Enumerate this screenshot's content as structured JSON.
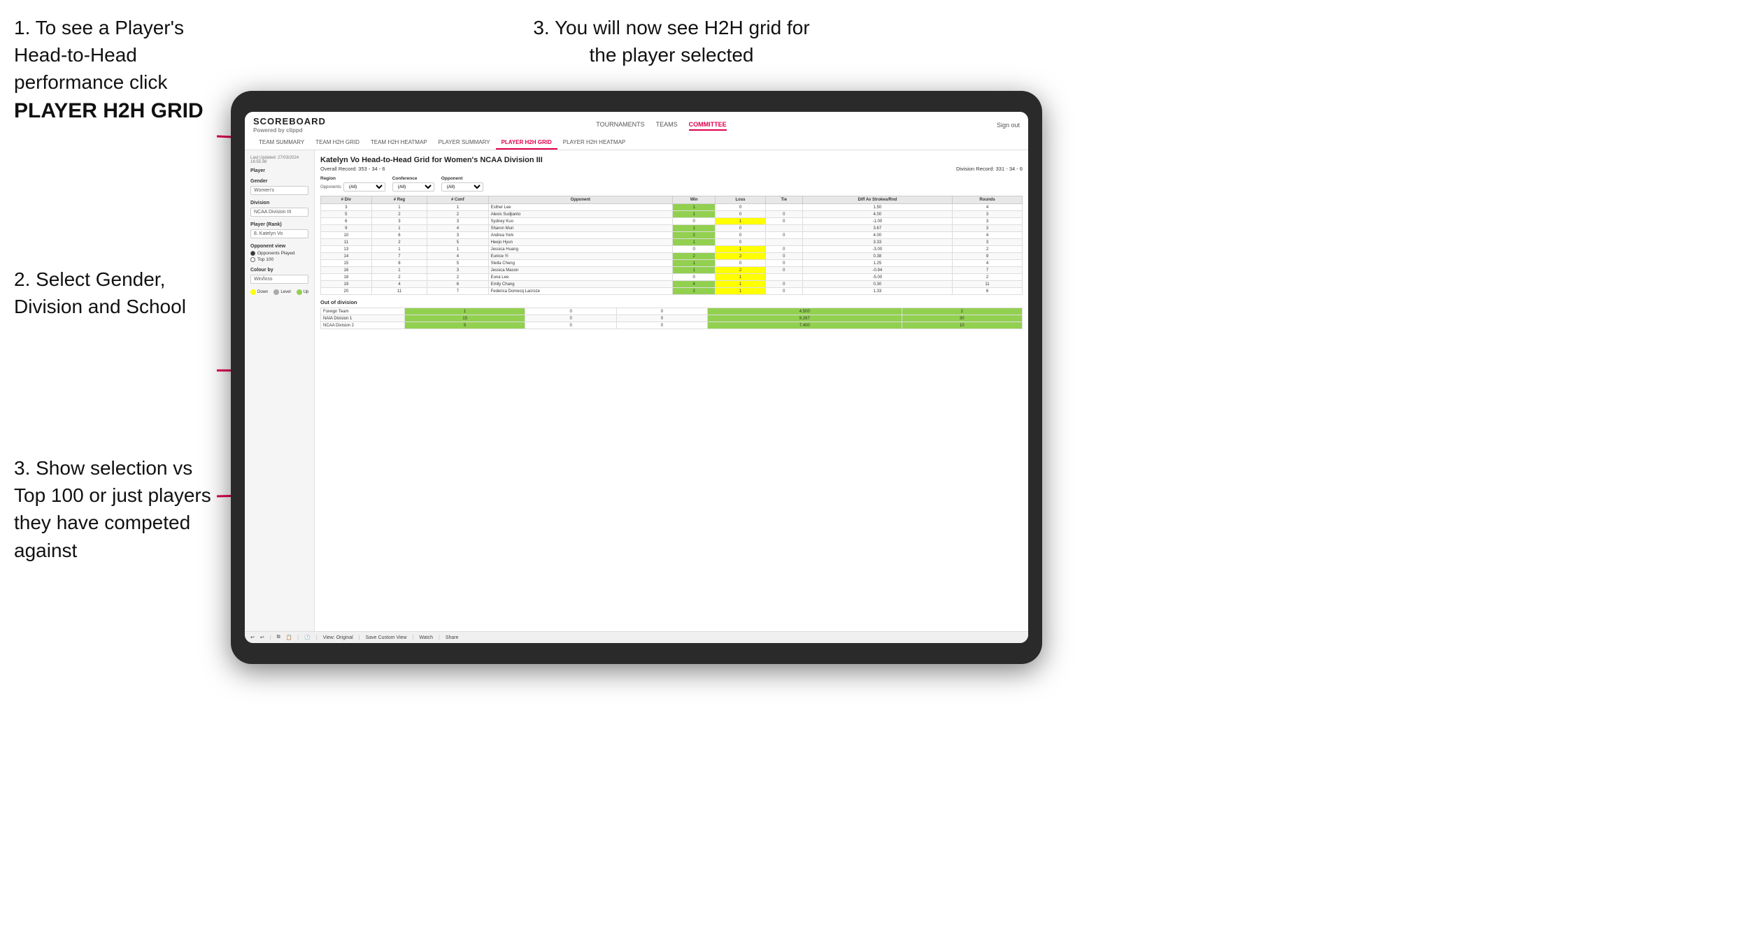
{
  "instructions": {
    "top_left_1": "1. To see a Player's Head-to-Head performance click",
    "top_left_2": "PLAYER H2H GRID",
    "top_right": "3. You will now see H2H grid for the player selected",
    "mid_left_title": "2. Select Gender, Division and School",
    "bottom_left_title": "3. Show selection vs Top 100 or just players they have competed against"
  },
  "nav": {
    "logo_main": "SCOREBOARD",
    "logo_sub": "Powered by clippd",
    "links": [
      "TOURNAMENTS",
      "TEAMS",
      "COMMITTEE"
    ],
    "active_link": "COMMITTEE",
    "sign_out": "Sign out",
    "sub_links": [
      "TEAM SUMMARY",
      "TEAM H2H GRID",
      "TEAM H2H HEATMAP",
      "PLAYER SUMMARY",
      "PLAYER H2H GRID",
      "PLAYER H2H HEATMAP"
    ],
    "active_sub": "PLAYER H2H GRID"
  },
  "sidebar": {
    "timestamp": "Last Updated: 27/03/2024 16:55:38",
    "player_label": "Player",
    "gender_label": "Gender",
    "gender_value": "Women's",
    "division_label": "Division",
    "division_value": "NCAA Division III",
    "player_rank_label": "Player (Rank)",
    "player_rank_value": "8. Katelyn Vo",
    "opponent_view_label": "Opponent view",
    "radio_opponents": "Opponents Played",
    "radio_top100": "Top 100",
    "colour_by_label": "Colour by",
    "colour_by_value": "Win/loss",
    "legend_down": "Down",
    "legend_level": "Level",
    "legend_up": "Up"
  },
  "grid": {
    "title": "Katelyn Vo Head-to-Head Grid for Women's NCAA Division III",
    "overall_record": "Overall Record: 353 - 34 - 6",
    "division_record": "Division Record: 331 - 34 - 6",
    "region_label": "Region",
    "conference_label": "Conference",
    "opponent_label": "Opponent",
    "opponents_label": "Opponents:",
    "opponents_value": "(All)",
    "columns": [
      "# Div",
      "# Reg",
      "# Conf",
      "Opponent",
      "Win",
      "Loss",
      "Tie",
      "Diff Av Strokes/Rnd",
      "Rounds"
    ],
    "rows": [
      {
        "div": "3",
        "reg": "1",
        "conf": "1",
        "name": "Esther Lee",
        "win": "1",
        "loss": "0",
        "tie": "",
        "diff": "1.50",
        "rounds": "4",
        "win_color": "green",
        "loss_color": "",
        "tie_color": ""
      },
      {
        "div": "5",
        "reg": "2",
        "conf": "2",
        "name": "Alexis Sudjianto",
        "win": "1",
        "loss": "0",
        "tie": "0",
        "diff": "4.00",
        "rounds": "3",
        "win_color": "green",
        "loss_color": "",
        "tie_color": ""
      },
      {
        "div": "6",
        "reg": "3",
        "conf": "3",
        "name": "Sydney Kuo",
        "win": "0",
        "loss": "1",
        "tie": "0",
        "diff": "-1.00",
        "rounds": "3",
        "win_color": "",
        "loss_color": "yellow",
        "tie_color": ""
      },
      {
        "div": "9",
        "reg": "1",
        "conf": "4",
        "name": "Sharon Mun",
        "win": "1",
        "loss": "0",
        "tie": "",
        "diff": "3.67",
        "rounds": "3",
        "win_color": "green",
        "loss_color": "",
        "tie_color": ""
      },
      {
        "div": "10",
        "reg": "6",
        "conf": "3",
        "name": "Andrea York",
        "win": "2",
        "loss": "0",
        "tie": "0",
        "diff": "4.00",
        "rounds": "4",
        "win_color": "green",
        "loss_color": "",
        "tie_color": ""
      },
      {
        "div": "11",
        "reg": "2",
        "conf": "5",
        "name": "Heejo Hyun",
        "win": "1",
        "loss": "0",
        "tie": "",
        "diff": "3.33",
        "rounds": "3",
        "win_color": "green",
        "loss_color": "",
        "tie_color": ""
      },
      {
        "div": "13",
        "reg": "1",
        "conf": "1",
        "name": "Jessica Huang",
        "win": "0",
        "loss": "1",
        "tie": "0",
        "diff": "-3.00",
        "rounds": "2",
        "win_color": "",
        "loss_color": "yellow",
        "tie_color": ""
      },
      {
        "div": "14",
        "reg": "7",
        "conf": "4",
        "name": "Eunice Yi",
        "win": "2",
        "loss": "2",
        "tie": "0",
        "diff": "0.38",
        "rounds": "9",
        "win_color": "green",
        "loss_color": "yellow",
        "tie_color": ""
      },
      {
        "div": "15",
        "reg": "8",
        "conf": "5",
        "name": "Stella Cheng",
        "win": "1",
        "loss": "0",
        "tie": "0",
        "diff": "1.25",
        "rounds": "4",
        "win_color": "green",
        "loss_color": "",
        "tie_color": ""
      },
      {
        "div": "16",
        "reg": "1",
        "conf": "3",
        "name": "Jessica Mason",
        "win": "1",
        "loss": "2",
        "tie": "0",
        "diff": "-0.94",
        "rounds": "7",
        "win_color": "green",
        "loss_color": "yellow",
        "tie_color": ""
      },
      {
        "div": "18",
        "reg": "2",
        "conf": "2",
        "name": "Euna Lee",
        "win": "0",
        "loss": "1",
        "tie": "",
        "diff": "-5.00",
        "rounds": "2",
        "win_color": "",
        "loss_color": "yellow",
        "tie_color": ""
      },
      {
        "div": "19",
        "reg": "4",
        "conf": "6",
        "name": "Emily Chang",
        "win": "4",
        "loss": "1",
        "tie": "0",
        "diff": "0.30",
        "rounds": "11",
        "win_color": "green",
        "loss_color": "yellow",
        "tie_color": ""
      },
      {
        "div": "20",
        "reg": "11",
        "conf": "7",
        "name": "Federica Domecq Lacroze",
        "win": "2",
        "loss": "1",
        "tie": "0",
        "diff": "1.33",
        "rounds": "6",
        "win_color": "green",
        "loss_color": "yellow",
        "tie_color": ""
      }
    ],
    "out_of_division_label": "Out of division",
    "out_of_division_rows": [
      {
        "name": "Foreign Team",
        "win": "1",
        "loss": "0",
        "tie": "0",
        "diff": "4.500",
        "rounds": "2"
      },
      {
        "name": "NAIA Division 1",
        "win": "15",
        "loss": "0",
        "tie": "0",
        "diff": "9.267",
        "rounds": "30"
      },
      {
        "name": "NCAA Division 2",
        "win": "5",
        "loss": "0",
        "tie": "0",
        "diff": "7.400",
        "rounds": "10"
      }
    ]
  },
  "toolbar": {
    "view_original": "View: Original",
    "save_custom": "Save Custom View",
    "watch": "Watch",
    "share": "Share"
  }
}
